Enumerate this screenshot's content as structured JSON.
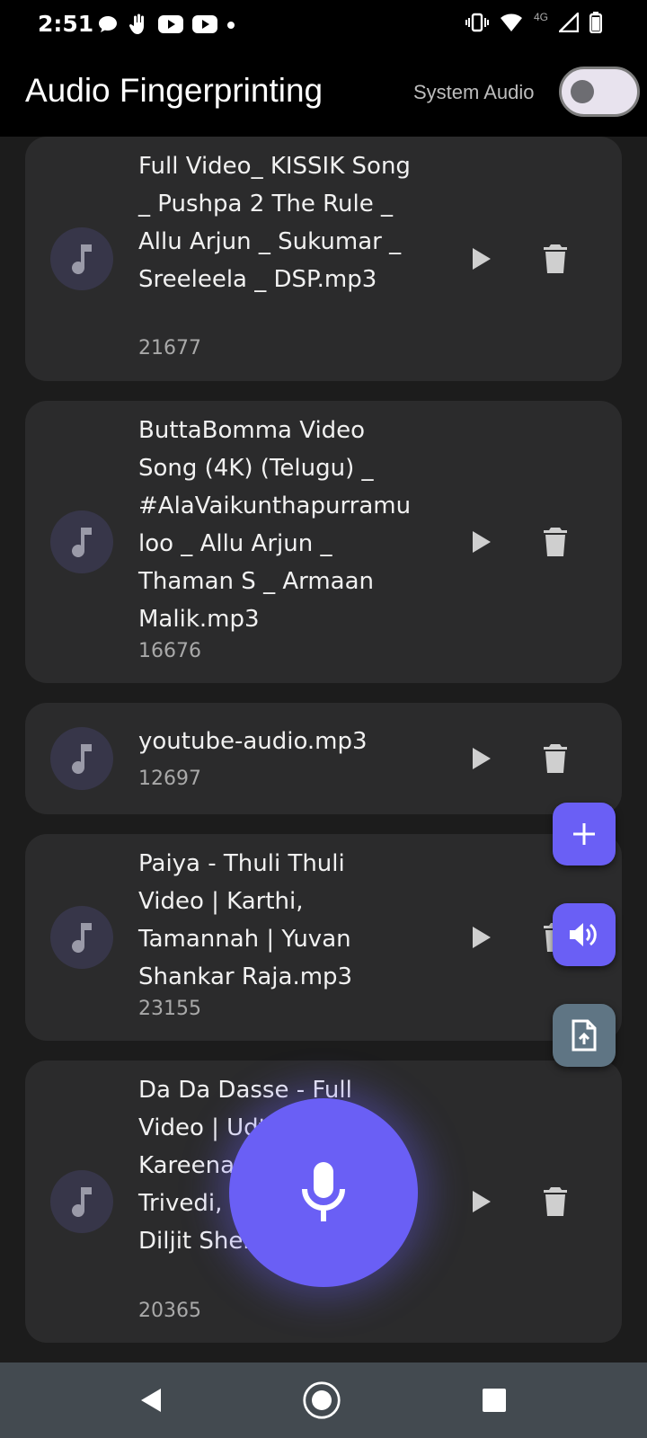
{
  "status_bar": {
    "time": "2:51",
    "left_icons": [
      "chat-bubble-icon",
      "hand-icon",
      "youtube-icon",
      "youtube-icon",
      "dot-icon"
    ],
    "network_label": "4G",
    "right_icons": [
      "vibrate-icon",
      "wifi-icon",
      "signal-icon",
      "battery-icon"
    ]
  },
  "app_bar": {
    "title": "Audio Fingerprinting",
    "toggle_label": "System Audio",
    "toggle_on": false
  },
  "tracks": [
    {
      "title": "Full Video_ KISSIK Song _ Pushpa 2 The Rule _ Allu Arjun _ Sukumar _ Sreeleela _ DSP.mp3",
      "count": "21677"
    },
    {
      "title": "ButtaBomma Video Song (4K) (Telugu) _ #AlaVaikunthapurramuloo _ Allu Arjun _ Thaman S _ Armaan Malik.mp3",
      "count": "16676"
    },
    {
      "title": "youtube-audio.mp3",
      "count": "12697"
    },
    {
      "title": "Paiya - Thuli Thuli Video | Karthi, Tamannah | Yuvan Shankar Raja.mp3",
      "count": "23155"
    },
    {
      "title": "Da Da Dasse - Full Video | Udta Punjab | Kareena Kapoor | Amit Trivedi, Shahid Kapoor, Diljit Shellee.mp3",
      "count": "20365"
    }
  ],
  "fabs": {
    "add": "plus-icon",
    "volume": "volume-icon",
    "upload": "file-upload-icon",
    "record": "microphone-icon"
  },
  "colors": {
    "accent": "#6a5ff5",
    "upload_fab": "#5f7584",
    "card": "#2b2b2c",
    "background": "#1c1c1c",
    "nav_bar": "#434a50"
  }
}
